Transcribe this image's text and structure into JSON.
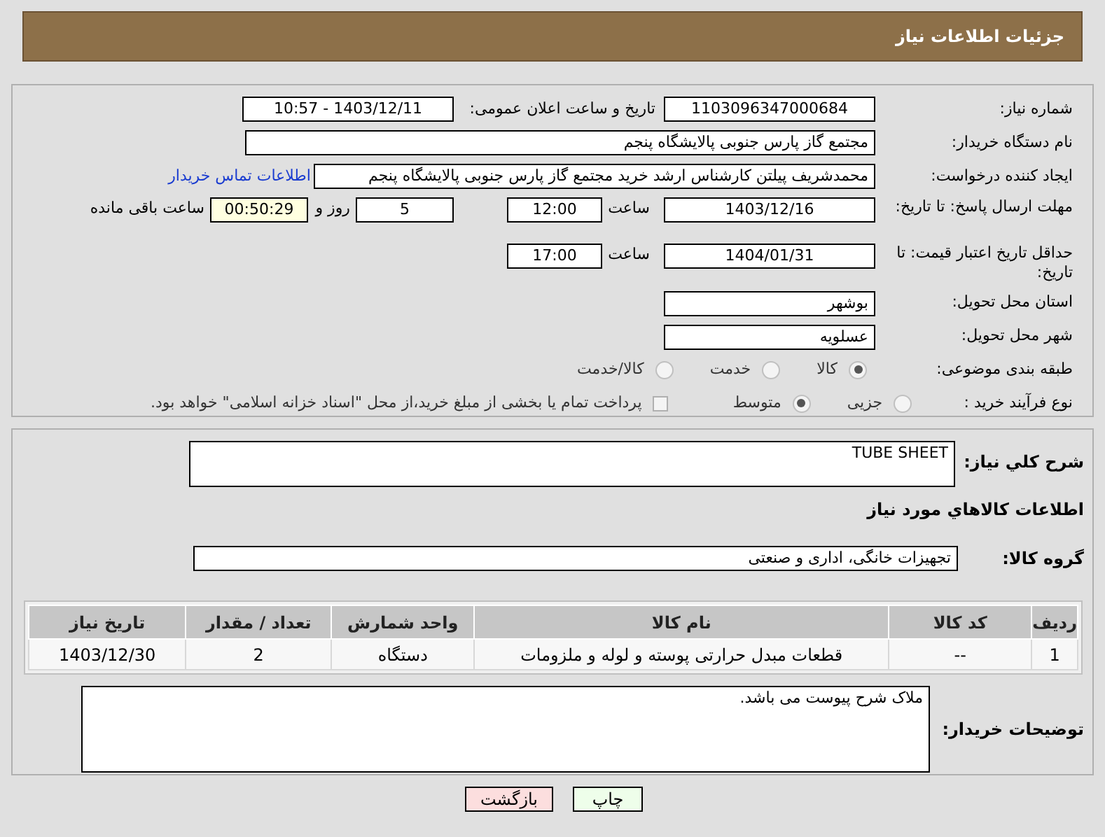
{
  "header": {
    "title": "جزئیات اطلاعات نیاز"
  },
  "need_number": {
    "label": "شماره نیاز:",
    "value": "1103096347000684"
  },
  "announce": {
    "label": "تاریخ و ساعت اعلان عمومی:",
    "value": "1403/12/11 - 10:57"
  },
  "buyer_org": {
    "label": "نام دستگاه خریدار:",
    "value": "مجتمع گاز پارس جنوبی  پالایشگاه پنجم"
  },
  "requester": {
    "label": "ایجاد کننده درخواست:",
    "value": "محمدشریف پیلتن کارشناس ارشد خرید مجتمع گاز پارس جنوبی  پالایشگاه پنجم",
    "link": "اطلاعات تماس خریدار"
  },
  "reply_deadline": {
    "label": "مهلت ارسال پاسخ: تا تاریخ:",
    "date": "1403/12/16",
    "time_label": "ساعت",
    "time": "12:00",
    "days": "5",
    "days_label": "روز و",
    "remaining": "00:50:29",
    "remaining_label": "ساعت باقی مانده"
  },
  "price_validity": {
    "label": "حداقل تاریخ اعتبار قیمت: تا تاریخ:",
    "date": "1404/01/31",
    "time_label": "ساعت",
    "time": "17:00"
  },
  "province": {
    "label": "استان محل تحویل:",
    "value": "بوشهر"
  },
  "city": {
    "label": "شهر محل تحویل:",
    "value": "عسلویه"
  },
  "category": {
    "label": "طبقه بندی موضوعی:",
    "options": [
      {
        "label": "کالا",
        "selected": true
      },
      {
        "label": "خدمت",
        "selected": false
      },
      {
        "label": "کالا/خدمت",
        "selected": false
      }
    ]
  },
  "process": {
    "label": "نوع فرآیند خرید :",
    "options": [
      {
        "label": "جزیی",
        "selected": false
      },
      {
        "label": "متوسط",
        "selected": true
      }
    ],
    "checkbox": {
      "label": "پرداخت تمام یا بخشی از مبلغ خرید،از محل \"اسناد خزانه اسلامی\" خواهد بود.",
      "checked": false
    }
  },
  "description": {
    "label": "شرح کلي نياز:",
    "value": "TUBE SHEET"
  },
  "goods_heading": "اطلاعات كالاهاي مورد نياز",
  "goods_group": {
    "label": "گروه کالا:",
    "value": "تجهیزات خانگی، اداری و صنعتی"
  },
  "table": {
    "columns": [
      "ردیف",
      "کد کالا",
      "نام کالا",
      "واحد شمارش",
      "تعداد / مقدار",
      "تاریخ نیاز"
    ],
    "rows": [
      [
        "1",
        "--",
        "قطعات مبدل حرارتی پوسته و لوله و ملزومات",
        "دستگاه",
        "2",
        "1403/12/30"
      ]
    ]
  },
  "buyer_notes": {
    "label": "توضیحات خریدار:",
    "value": "ملاک شرح پیوست می باشد."
  },
  "buttons": [
    {
      "label": "چاپ",
      "kind": "print"
    },
    {
      "label": "بازگشت",
      "kind": "back"
    }
  ]
}
